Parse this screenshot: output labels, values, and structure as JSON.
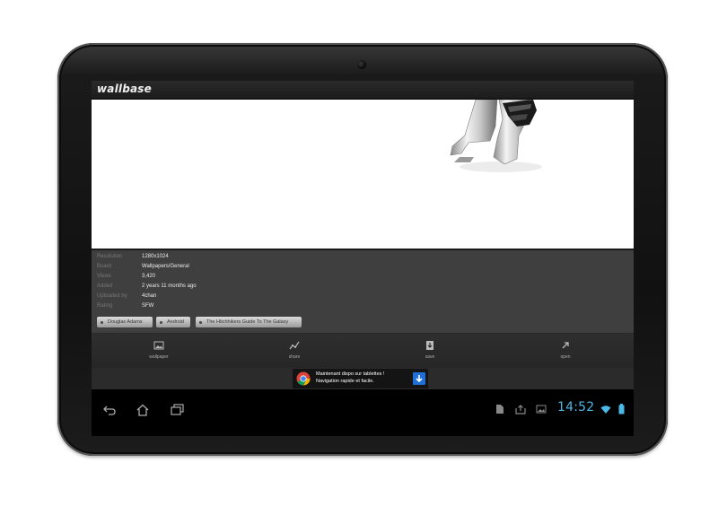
{
  "app": {
    "title": "wallbase"
  },
  "info": [
    {
      "label": "Resolution",
      "value": "1280x1024"
    },
    {
      "label": "Board",
      "value": "Wallpapers/General"
    },
    {
      "label": "Views",
      "value": "3,420"
    },
    {
      "label": "Added",
      "value": "2 years 11 months ago"
    },
    {
      "label": "Uploaded by",
      "value": "4chan"
    },
    {
      "label": "Rating",
      "value": "SFW"
    }
  ],
  "tags": [
    "Douglas Adams",
    "Android",
    "The Hitchhikers Guide To The Galaxy"
  ],
  "actions": [
    {
      "label": "wallpaper",
      "icon": "image-icon"
    },
    {
      "label": "share",
      "icon": "share-icon"
    },
    {
      "label": "save",
      "icon": "download-icon"
    },
    {
      "label": "open",
      "icon": "open-external-icon"
    }
  ],
  "ad": {
    "line1": "Maintenant dispo sur tablettes !",
    "line2": "Navigation rapide et facile.",
    "icon": "chrome-logo-icon"
  },
  "statusbar": {
    "time": "14:52"
  },
  "colors": {
    "clock": "#4bb8e6",
    "battery": "#4bb8e6",
    "ad_download": "#1f6fd6"
  }
}
